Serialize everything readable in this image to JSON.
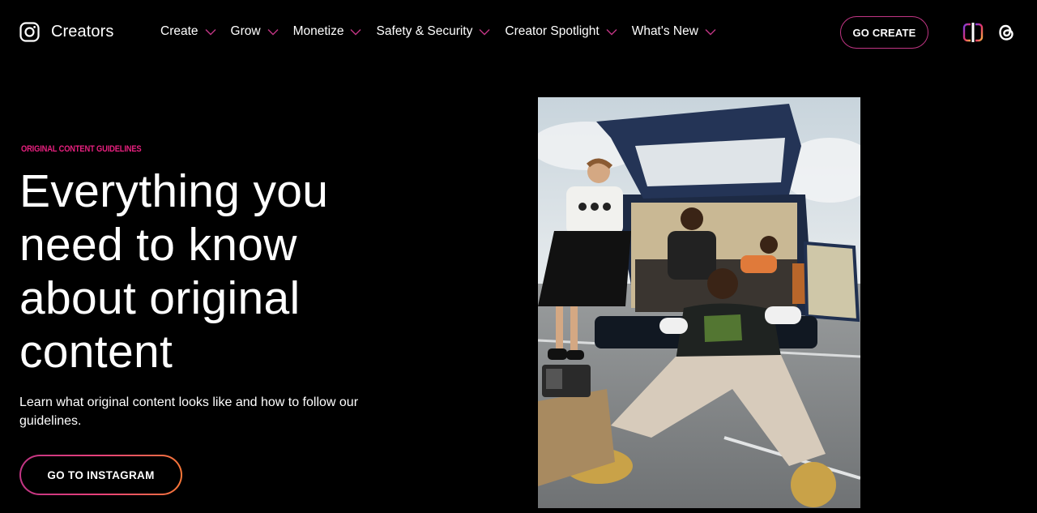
{
  "header": {
    "brand": "Creators",
    "nav": [
      {
        "label": "Create"
      },
      {
        "label": "Grow"
      },
      {
        "label": "Monetize"
      },
      {
        "label": "Safety & Security"
      },
      {
        "label": "Creator Spotlight"
      },
      {
        "label": "What's New"
      }
    ],
    "cta_label": "GO CREATE",
    "icons": [
      "instagram-icon",
      "chevron-down-icon",
      "edits-icon",
      "threads-icon"
    ]
  },
  "hero": {
    "eyebrow": "ORIGINAL CONTENT GUIDELINES",
    "headline": "Everything you need to know about original content",
    "subtext": "Learn what original content looks like and how to follow our guidelines.",
    "button_label": "GO TO INSTAGRAM"
  },
  "colors": {
    "background": "#000000",
    "accent_pink": "#e8207f",
    "gradient": [
      "#c13584",
      "#e8407a",
      "#f77737"
    ]
  }
}
